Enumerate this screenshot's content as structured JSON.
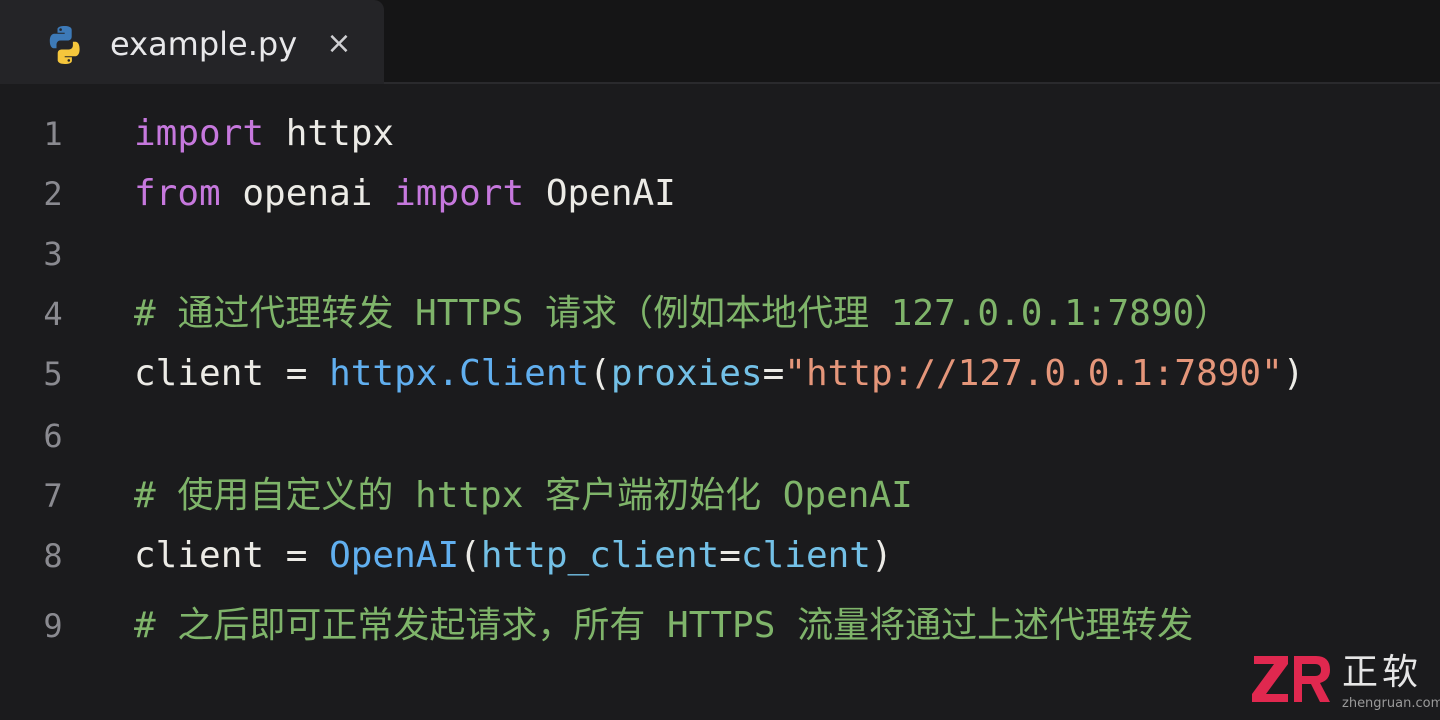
{
  "tab": {
    "icon": "python-icon",
    "filename": "example.py",
    "close_symbol": "×"
  },
  "colors": {
    "background": "#1b1b1d",
    "keyword": "#c678dd",
    "function": "#61afef",
    "string": "#e5967a",
    "parameter": "#73c0e6",
    "comment": "#7fb46a",
    "text": "#ecebe6",
    "line_number": "#8a8a90"
  },
  "lines": [
    {
      "number": "1",
      "tokens": [
        {
          "t": "kw",
          "v": "import"
        },
        {
          "t": "plain",
          "v": " httpx"
        }
      ]
    },
    {
      "number": "2",
      "tokens": [
        {
          "t": "kw",
          "v": "from"
        },
        {
          "t": "plain",
          "v": " openai "
        },
        {
          "t": "kw",
          "v": "import"
        },
        {
          "t": "plain",
          "v": " OpenAI"
        }
      ]
    },
    {
      "number": "3",
      "tokens": []
    },
    {
      "number": "4",
      "tokens": [
        {
          "t": "cm",
          "v": "# 通过代理转发 HTTPS 请求（例如本地代理 127.0.0.1:7890）"
        }
      ]
    },
    {
      "number": "5",
      "tokens": [
        {
          "t": "plain",
          "v": "client = "
        },
        {
          "t": "fn",
          "v": "httpx.Client"
        },
        {
          "t": "plain",
          "v": "("
        },
        {
          "t": "param",
          "v": "proxies"
        },
        {
          "t": "plain",
          "v": "="
        },
        {
          "t": "str",
          "v": "\"http://127.0.0.1:7890\""
        },
        {
          "t": "plain",
          "v": ")"
        }
      ]
    },
    {
      "number": "6",
      "tokens": []
    },
    {
      "number": "7",
      "tokens": [
        {
          "t": "cm",
          "v": "# 使用自定义的 httpx 客户端初始化 OpenAI"
        }
      ]
    },
    {
      "number": "8",
      "tokens": [
        {
          "t": "plain",
          "v": "client = "
        },
        {
          "t": "fn",
          "v": "OpenAI"
        },
        {
          "t": "plain",
          "v": "("
        },
        {
          "t": "param",
          "v": "http_client"
        },
        {
          "t": "plain",
          "v": "="
        },
        {
          "t": "param",
          "v": "client"
        },
        {
          "t": "plain",
          "v": ")"
        }
      ]
    },
    {
      "number": "9",
      "tokens": [
        {
          "t": "cm",
          "v": "# 之后即可正常发起请求，所有 HTTPS 流量将通过上述代理转发"
        }
      ]
    }
  ],
  "watermark": {
    "logo": "ZR",
    "name": "正软",
    "url": "zhengruan.com"
  }
}
